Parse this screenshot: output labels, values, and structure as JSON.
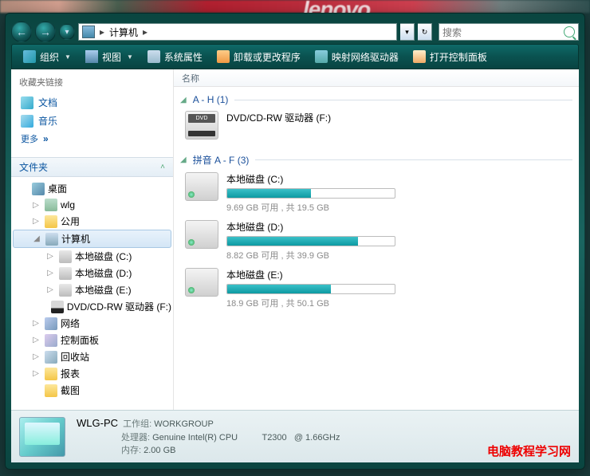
{
  "titlebar": {
    "lenovo": "lenovo",
    "breadcrumb": {
      "root": "计算机"
    },
    "search_placeholder": "搜索"
  },
  "cmdbar": {
    "organize": "组织",
    "views": "视图",
    "sysprop": "系统属性",
    "uninstall": "卸载或更改程序",
    "netdrive": "映射网络驱动器",
    "cpanel": "打开控制面板"
  },
  "favlinks": {
    "header": "收藏夹链接",
    "docs": "文档",
    "music": "音乐",
    "more": "更多"
  },
  "folders": {
    "header": "文件夹"
  },
  "tree": {
    "desktop": "桌面",
    "user": "wlg",
    "public": "公用",
    "computer": "计算机",
    "c": "本地磁盘 (C:)",
    "d": "本地磁盘 (D:)",
    "e": "本地磁盘 (E:)",
    "f": "DVD/CD-RW 驱动器 (F:)",
    "network": "网络",
    "cp": "控制面板",
    "recycle": "回收站",
    "baobiao": "报表",
    "jietu": "截图"
  },
  "main": {
    "col_name": "名称",
    "group1": {
      "header": "A - H (1)",
      "dvd": "DVD/CD-RW 驱动器 (F:)"
    },
    "group2": {
      "header": "拼音 A - F (3)",
      "drives": [
        {
          "name": "本地磁盘 (C:)",
          "free": "9.69 GB 可用 , 共 19.5 GB",
          "pct": 50
        },
        {
          "name": "本地磁盘 (D:)",
          "free": "8.82 GB 可用 , 共 39.9 GB",
          "pct": 78
        },
        {
          "name": "本地磁盘 (E:)",
          "free": "18.9 GB 可用 , 共 50.1 GB",
          "pct": 62
        }
      ]
    }
  },
  "details": {
    "name": "WLG-PC",
    "workgroup_l": "工作组:",
    "workgroup": "WORKGROUP",
    "cpu_l": "处理器:",
    "cpu": "Genuine Intel(R) CPU          T2300   @ 1.66GHz",
    "mem_l": "内存:",
    "mem": "2.00 GB"
  },
  "watermark": "电脑教程学习网"
}
